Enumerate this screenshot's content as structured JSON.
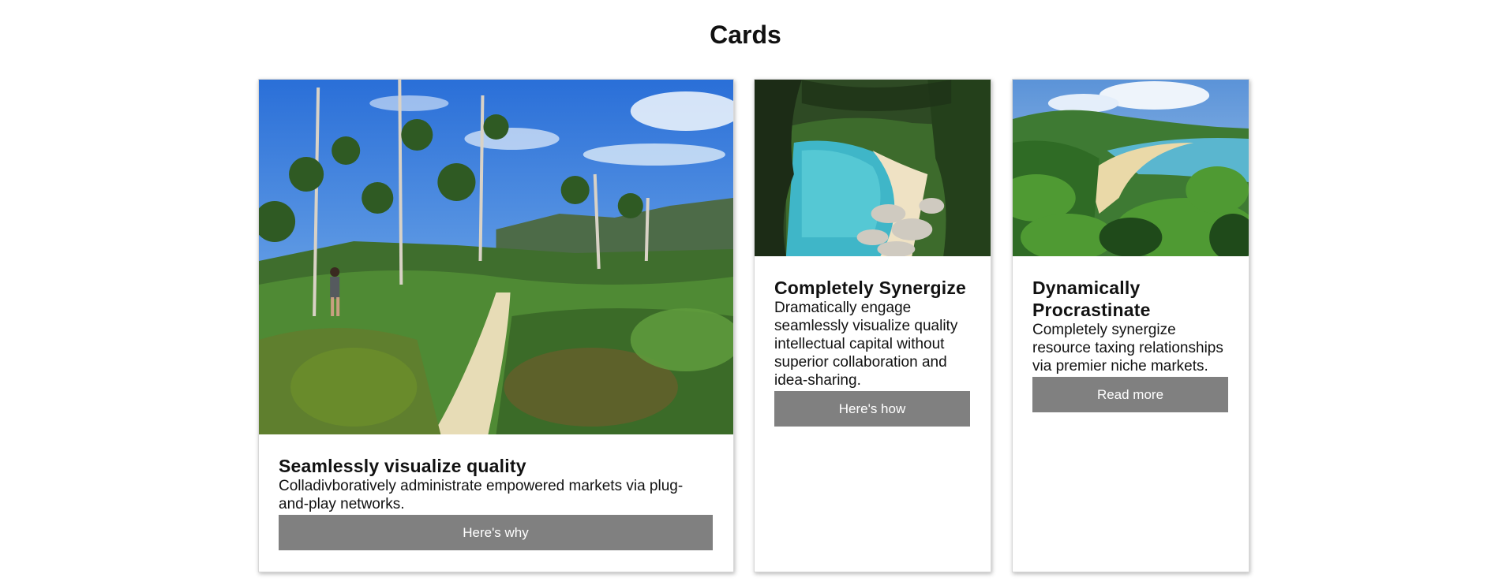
{
  "page": {
    "title": "Cards"
  },
  "cards": [
    {
      "image_alt": "hiker on sandy trail through ferns and trees",
      "title": "Seamlessly visualize quality",
      "text": "Colladivboratively administrate empowered markets via plug-and-play networks.",
      "button_label": "Here's why"
    },
    {
      "image_alt": "turquoise cove with rocky beach",
      "title": "Completely Synergize",
      "text": "Dramatically engage seamlessly visualize quality intellectual capital without superior collaboration and idea-sharing.",
      "button_label": "Here's how"
    },
    {
      "image_alt": "sandy bay viewed through tree ferns",
      "title": "Dynamically Procrastinate",
      "text": "Completely synergize resource taxing relationships via premier niche markets.",
      "button_label": "Read more"
    }
  ],
  "colors": {
    "button_background": "#808080",
    "button_text": "#ffffff",
    "card_border": "#d8d8d8"
  }
}
